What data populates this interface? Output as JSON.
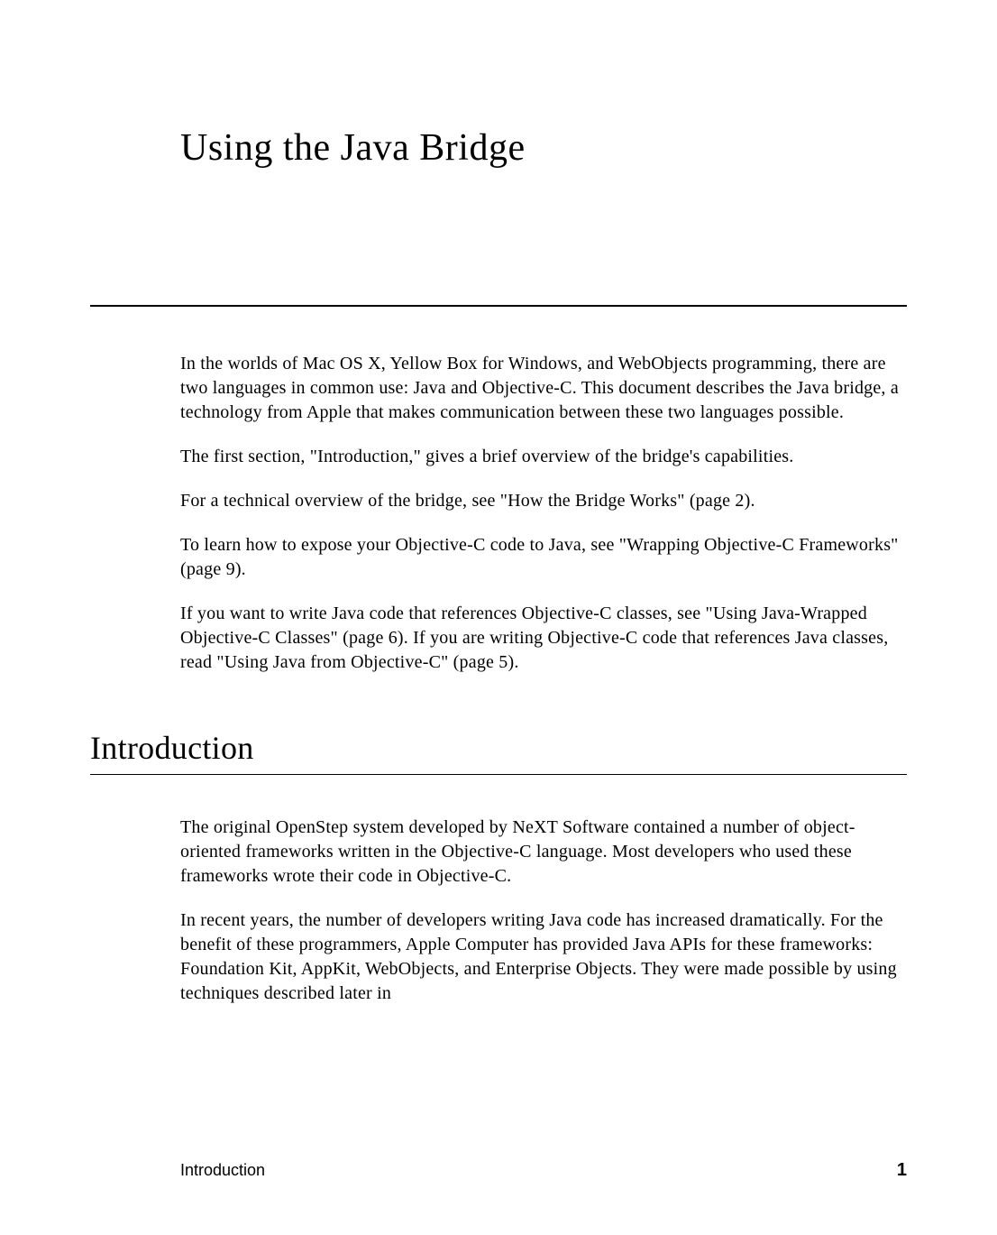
{
  "chapter": {
    "title": "Using the Java Bridge"
  },
  "intro_paragraphs": {
    "p1": "In the worlds of Mac OS X, Yellow Box for Windows, and WebObjects programming, there are two languages in common use: Java and Objective-C. This document describes the Java bridge, a technology from Apple that makes communication between these two languages possible.",
    "p2": "The first section, \"Introduction,\" gives a brief overview of the bridge's capabilities.",
    "p3": "For a technical overview of the bridge, see \"How the Bridge Works\" (page 2).",
    "p4": "To learn how to expose your Objective-C code to Java, see \"Wrapping Objective-C Frameworks\" (page 9).",
    "p5": "If you want to write Java code that references Objective-C classes, see \"Using Java-Wrapped Objective-C Classes\" (page 6). If you are writing Objective-C code that references Java classes, read \"Using Java from Objective-C\" (page 5)."
  },
  "section": {
    "heading": "Introduction",
    "p1": "The original OpenStep system developed by NeXT Software contained a number of object-oriented frameworks written in the Objective-C language. Most developers who used these frameworks wrote their code in Objective-C.",
    "p2": "In recent years, the number of developers writing Java code has increased dramatically. For the benefit of these programmers, Apple Computer has provided Java APIs for these frameworks: Foundation Kit, AppKit, WebObjects, and Enterprise Objects. They were made possible by using techniques described later in"
  },
  "footer": {
    "label": "Introduction",
    "page_number": "1"
  }
}
